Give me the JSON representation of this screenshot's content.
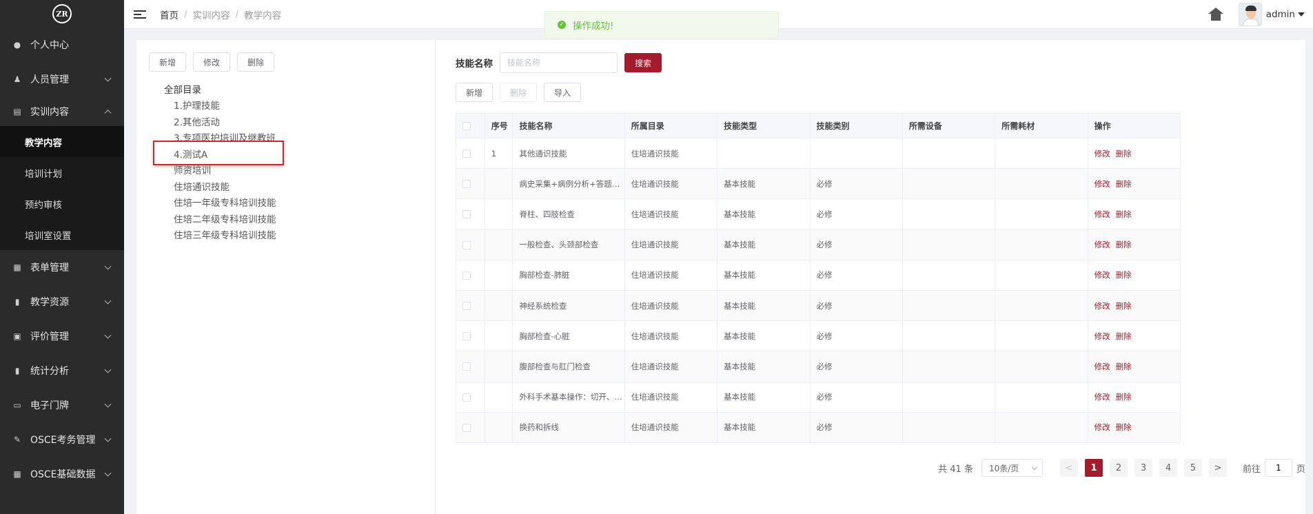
{
  "logo": {
    "text": "ZR"
  },
  "sidebar": {
    "items": [
      {
        "label": "个人中心",
        "icon": "user-icon",
        "glyph": "●",
        "has_arrow": false
      },
      {
        "label": "人员管理",
        "icon": "users-icon",
        "glyph": "♟",
        "has_arrow": true
      },
      {
        "label": "实训内容",
        "icon": "book-icon",
        "glyph": "▤",
        "has_arrow": true,
        "open": true
      },
      {
        "label": "表单管理",
        "icon": "form-icon",
        "glyph": "▦",
        "has_arrow": true
      },
      {
        "label": "教学资源",
        "icon": "resource-icon",
        "glyph": "▮",
        "has_arrow": true
      },
      {
        "label": "评价管理",
        "icon": "evaluate-icon",
        "glyph": "▣",
        "has_arrow": true
      },
      {
        "label": "统计分析",
        "icon": "bar-chart-icon",
        "glyph": "▮",
        "has_arrow": true
      },
      {
        "label": "电子门牌",
        "icon": "monitor-icon",
        "glyph": "▭",
        "has_arrow": true
      },
      {
        "label": "OSCE考务管理",
        "icon": "edit-icon",
        "glyph": "✎",
        "has_arrow": true
      },
      {
        "label": "OSCE基础数据",
        "icon": "grid-icon",
        "glyph": "▦",
        "has_arrow": true
      }
    ],
    "submenu": [
      {
        "label": "教学内容",
        "active": true
      },
      {
        "label": "培训计划",
        "active": false
      },
      {
        "label": "预约审核",
        "active": false
      },
      {
        "label": "培训室设置",
        "active": false
      }
    ]
  },
  "header": {
    "breadcrumb": [
      "首页",
      "实训内容",
      "教学内容"
    ],
    "separator": "/",
    "user_name": "admin"
  },
  "toast": {
    "message": "操作成功!",
    "type": "success"
  },
  "left_panel": {
    "buttons": {
      "add": "新增",
      "edit": "修改",
      "delete": "删除"
    },
    "tree": {
      "root": "全部目录",
      "nodes": [
        "1.护理技能",
        "2.其他活动",
        "3.专项医护培训及继教班",
        "4.测试A",
        "师资培训",
        "住培通识技能",
        "住培一年级专科培训技能",
        "住培二年级专科培训技能",
        "住培三年级专科培训技能"
      ],
      "highlighted_node": "4.测试A"
    }
  },
  "right_panel": {
    "search": {
      "label": "技能名称",
      "placeholder": "技能名称",
      "value": "",
      "button": "搜索"
    },
    "actions": {
      "add": "新增",
      "delete": "删除",
      "import": "导入"
    },
    "table": {
      "headers": [
        "序号",
        "技能名称",
        "所属目录",
        "技能类型",
        "技能类别",
        "所需设备",
        "所需耗材",
        "操作"
      ],
      "rows": [
        {
          "no": "1",
          "name": "其他通识技能",
          "dir": "住培通识技能",
          "type": "",
          "category": "",
          "equip": "",
          "material": ""
        },
        {
          "no": "",
          "name": "病史采集+病例分析+答题…",
          "dir": "住培通识技能",
          "type": "基本技能",
          "category": "必修",
          "equip": "",
          "material": ""
        },
        {
          "no": "",
          "name": "脊柱、四肢检查",
          "dir": "住培通识技能",
          "type": "基本技能",
          "category": "必修",
          "equip": "",
          "material": ""
        },
        {
          "no": "",
          "name": "一般检查、头颈部检查",
          "dir": "住培通识技能",
          "type": "基本技能",
          "category": "必修",
          "equip": "",
          "material": ""
        },
        {
          "no": "",
          "name": "胸部检查-肺脏",
          "dir": "住培通识技能",
          "type": "基本技能",
          "category": "必修",
          "equip": "",
          "material": ""
        },
        {
          "no": "",
          "name": "神经系统检查",
          "dir": "住培通识技能",
          "type": "基本技能",
          "category": "必修",
          "equip": "",
          "material": ""
        },
        {
          "no": "",
          "name": "胸部检查-心脏",
          "dir": "住培通识技能",
          "type": "基本技能",
          "category": "必修",
          "equip": "",
          "material": ""
        },
        {
          "no": "",
          "name": "腹部检查与肛门检查",
          "dir": "住培通识技能",
          "type": "基本技能",
          "category": "必修",
          "equip": "",
          "material": ""
        },
        {
          "no": "",
          "name": "外科手术基本操作：切开、…",
          "dir": "住培通识技能",
          "type": "基本技能",
          "category": "必修",
          "equip": "",
          "material": ""
        },
        {
          "no": "",
          "name": "换药和拆线",
          "dir": "住培通识技能",
          "type": "基本技能",
          "category": "必修",
          "equip": "",
          "material": ""
        }
      ],
      "op_edit": "修改",
      "op_delete": "删除"
    },
    "pagination": {
      "total": "共 41 条",
      "page_size": "10条/页",
      "pages": [
        "1",
        "2",
        "3",
        "4",
        "5"
      ],
      "current": "1",
      "prev": "<",
      "next": ">",
      "goto_label": "前往",
      "goto_value": "1",
      "goto_suffix": "页"
    }
  },
  "colors": {
    "accent": "#a31b2c",
    "sidebar_bg": "#2b2b2b",
    "submenu_bg": "#1a1a1a",
    "highlight_border": "#e0202a"
  }
}
